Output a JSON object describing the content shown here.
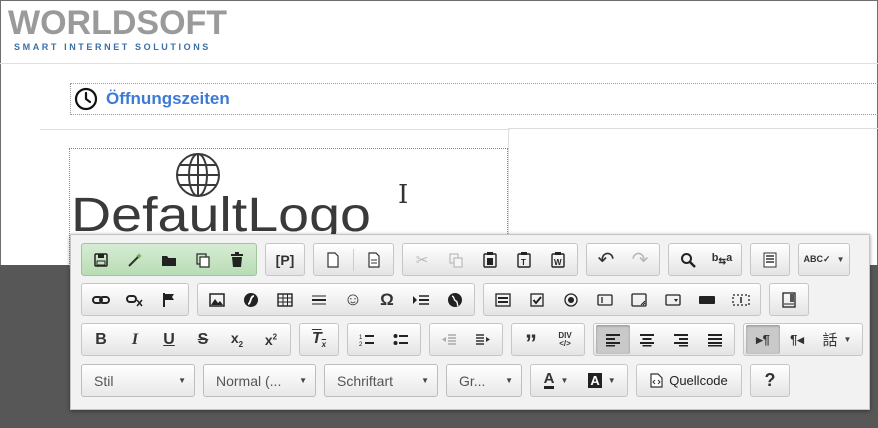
{
  "header": {
    "brand_main": "WORLDSOFT",
    "brand_sub": "SMART INTERNET SOLUTIONS"
  },
  "content": {
    "section_title": "Öffnungszeiten",
    "default_logo": "DefaultLogo"
  },
  "toolbar": {
    "combos": {
      "style": "Stil",
      "format": "Normal (...",
      "font": "Schriftart",
      "size": "Gr..."
    },
    "source_label": "Quellcode",
    "help_label": "?"
  },
  "colors": {
    "brand_blue": "#3b6fa8",
    "title_blue": "#3d7ad8",
    "toolbar_bg": "#f2f2f2",
    "dark_backdrop": "#575757"
  }
}
